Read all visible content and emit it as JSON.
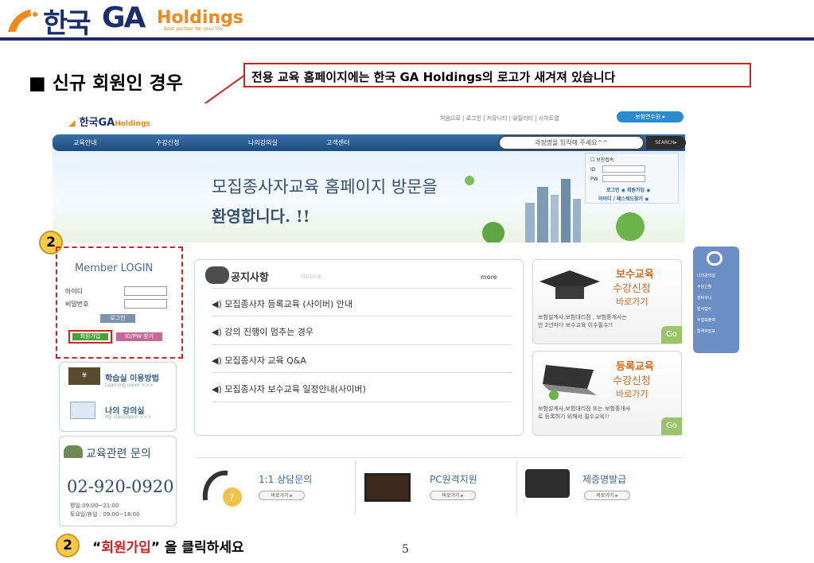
{
  "header": {
    "logo_kr": "한국",
    "logo_ga": "GA",
    "logo_holdings": "Holdings",
    "logo_tagline": "Best partner for your life"
  },
  "slide": {
    "heading": "■ 신규 회원인 경우",
    "callout": "전용 교육 홈페이지에는 한국 GA Holdings의 로고가 새겨져 있습니다",
    "page_number": "5",
    "bottom_badge": "2",
    "bottom_quote_open": "“",
    "bottom_highlight": "회원가입",
    "bottom_quote_rest": "” 을 클릭하세요",
    "step_badge": "2",
    "colors": {
      "accent": "#d32020",
      "brand_navy": "#1b2f6e",
      "brand_orange": "#f08a1c"
    }
  },
  "site": {
    "logo_kr": "한국",
    "logo_ga": "GA",
    "logo_holdings": "Holdings",
    "util_links": "처음으로 | 로그인 | 커뮤니티 | 유틸리티 | 사이트맵",
    "join_button": "보험연수원 ▸",
    "nav": [
      "교육안내",
      "수강신청",
      "나의강의실",
      "고객센터"
    ],
    "search_placeholder": "과정명을 입력해 주세요^^",
    "search_button": "SEARCH▸",
    "banner_line1": "모집종사자교육 홈페이지 방문을",
    "banner_line2": "환영합니다. !!",
    "mini_login": {
      "secure": "보안접속",
      "id": "ID",
      "pw": "PW",
      "login": "로그인 ◉  회원가입 ◉",
      "find": "아이디 / 패스워드찾기 ◉"
    },
    "member_login": "Member LOGIN",
    "id_label": "아이디",
    "pw_label": "비밀번호",
    "login_button": "로그인",
    "join_label": "회원가입",
    "find_label": "ID/PW 찾기",
    "study_room_title": "학습실 이용방법",
    "study_room_sub": "Learning room >>>",
    "my_class_title": "나의 강의실",
    "my_class_sub": "My classroom >>>",
    "contact_title": "교육관련 문의",
    "phone": "02-920-0920",
    "hours_weekday": "평일:09:00~21:00",
    "hours_weekend": "토요일/휴일 : 09:00~18:00",
    "notice_title": "공지사항",
    "notice_en": "Notice",
    "notice_more": "more",
    "notices": [
      "◀) 모집종사자 등록교육 (사이버) 안내",
      "◀) 강의 진행이 멈추는 경우",
      "◀) 모집종사자 교육 Q&A",
      "◀) 모집종사자 보수교육 일정안내(사이버)"
    ],
    "card1": {
      "t1": "보수교육",
      "t2": "수강신청",
      "t3": "바로가기",
      "d1": "보험설계사,보험대리점 , 보험중개사는",
      "d2": "만 2년마다 보수교육 이수필수!!",
      "go": "Go"
    },
    "card2": {
      "t1": "등록교육",
      "t2": "수강신청",
      "t3": "바로가기",
      "d1": "보험설계사,보험대리점 또는 보험중개사",
      "d2": "로 등록하기 위해서 필수교육!!",
      "go": "Go"
    },
    "side_menu": [
      "나의강의실",
      "수강신청",
      "장바구니",
      "원서접수",
      "수험표출력",
      "합격자발표"
    ],
    "services": [
      {
        "title": "1:1 상담문의",
        "btn": "바로가기 ▸"
      },
      {
        "title": "PC원격지원",
        "btn": "바로가기 ▸"
      },
      {
        "title": "제증명발급",
        "btn": "바로가기 ▸"
      }
    ]
  }
}
